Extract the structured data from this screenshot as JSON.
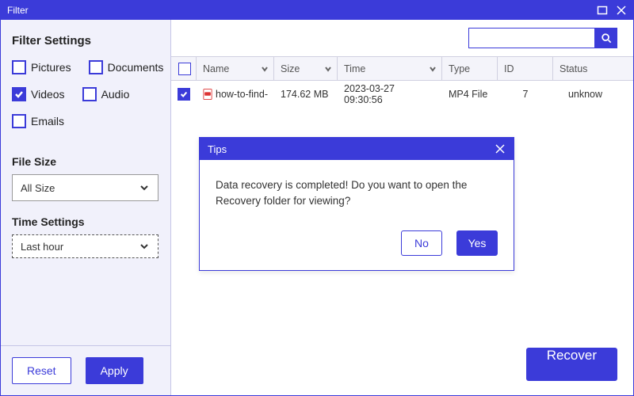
{
  "window": {
    "title": "Filter"
  },
  "sidebar": {
    "heading": "Filter Settings",
    "filters": {
      "pictures": {
        "label": "Pictures",
        "checked": false
      },
      "documents": {
        "label": "Documents",
        "checked": false
      },
      "videos": {
        "label": "Videos",
        "checked": true
      },
      "audio": {
        "label": "Audio",
        "checked": false
      },
      "emails": {
        "label": "Emails",
        "checked": false
      }
    },
    "filesize_label": "File Size",
    "filesize_value": "All Size",
    "time_label": "Time Settings",
    "time_value": "Last hour",
    "reset_label": "Reset",
    "apply_label": "Apply"
  },
  "search": {
    "value": "",
    "placeholder": ""
  },
  "table": {
    "columns": {
      "name": "Name",
      "size": "Size",
      "time": "Time",
      "type": "Type",
      "id": "ID",
      "status": "Status"
    },
    "rows": [
      {
        "checked": true,
        "icon": "mp4-file-icon",
        "name": "how-to-find-",
        "size": "174.62 MB",
        "time": "2023-03-27 09:30:56",
        "type": "MP4 File",
        "id": "7",
        "status": "unknow"
      }
    ]
  },
  "recover_label": "Recover",
  "modal": {
    "title": "Tips",
    "message": "Data recovery is completed! Do you want to open the Recovery folder for viewing?",
    "no_label": "No",
    "yes_label": "Yes"
  }
}
